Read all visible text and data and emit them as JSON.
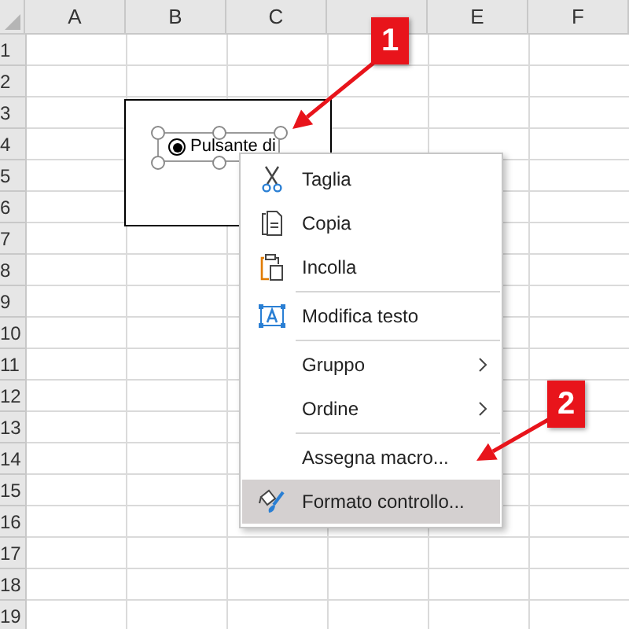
{
  "sheet": {
    "columns": [
      {
        "label": "A"
      },
      {
        "label": "B"
      },
      {
        "label": "C"
      },
      {
        "covered": true
      },
      {
        "label": "E"
      },
      {
        "label": "F"
      }
    ],
    "rows": [
      "1",
      "2",
      "3",
      "4",
      "5",
      "6",
      "7",
      "8",
      "9",
      "10",
      "11",
      "12",
      "13",
      "14",
      "15",
      "16",
      "17",
      "18",
      "19"
    ]
  },
  "control": {
    "label": "Pulsante di",
    "checked": true
  },
  "context_menu": {
    "items": [
      {
        "kind": "command",
        "label": "Taglia",
        "selected": false
      },
      {
        "kind": "command",
        "label": "Copia",
        "selected": false
      },
      {
        "kind": "command",
        "label": "Incolla",
        "selected": false
      },
      {
        "kind": "separator"
      },
      {
        "kind": "command",
        "label": "Modifica testo",
        "selected": false
      },
      {
        "kind": "separator"
      },
      {
        "kind": "submenu",
        "label": "Gruppo",
        "selected": false
      },
      {
        "kind": "submenu",
        "label": "Ordine",
        "selected": false
      },
      {
        "kind": "separator"
      },
      {
        "kind": "command",
        "label": "Assegna macro...",
        "selected": false
      },
      {
        "kind": "command",
        "label": "Formato controllo...",
        "selected": true
      }
    ]
  },
  "callouts": [
    "1",
    "2"
  ]
}
